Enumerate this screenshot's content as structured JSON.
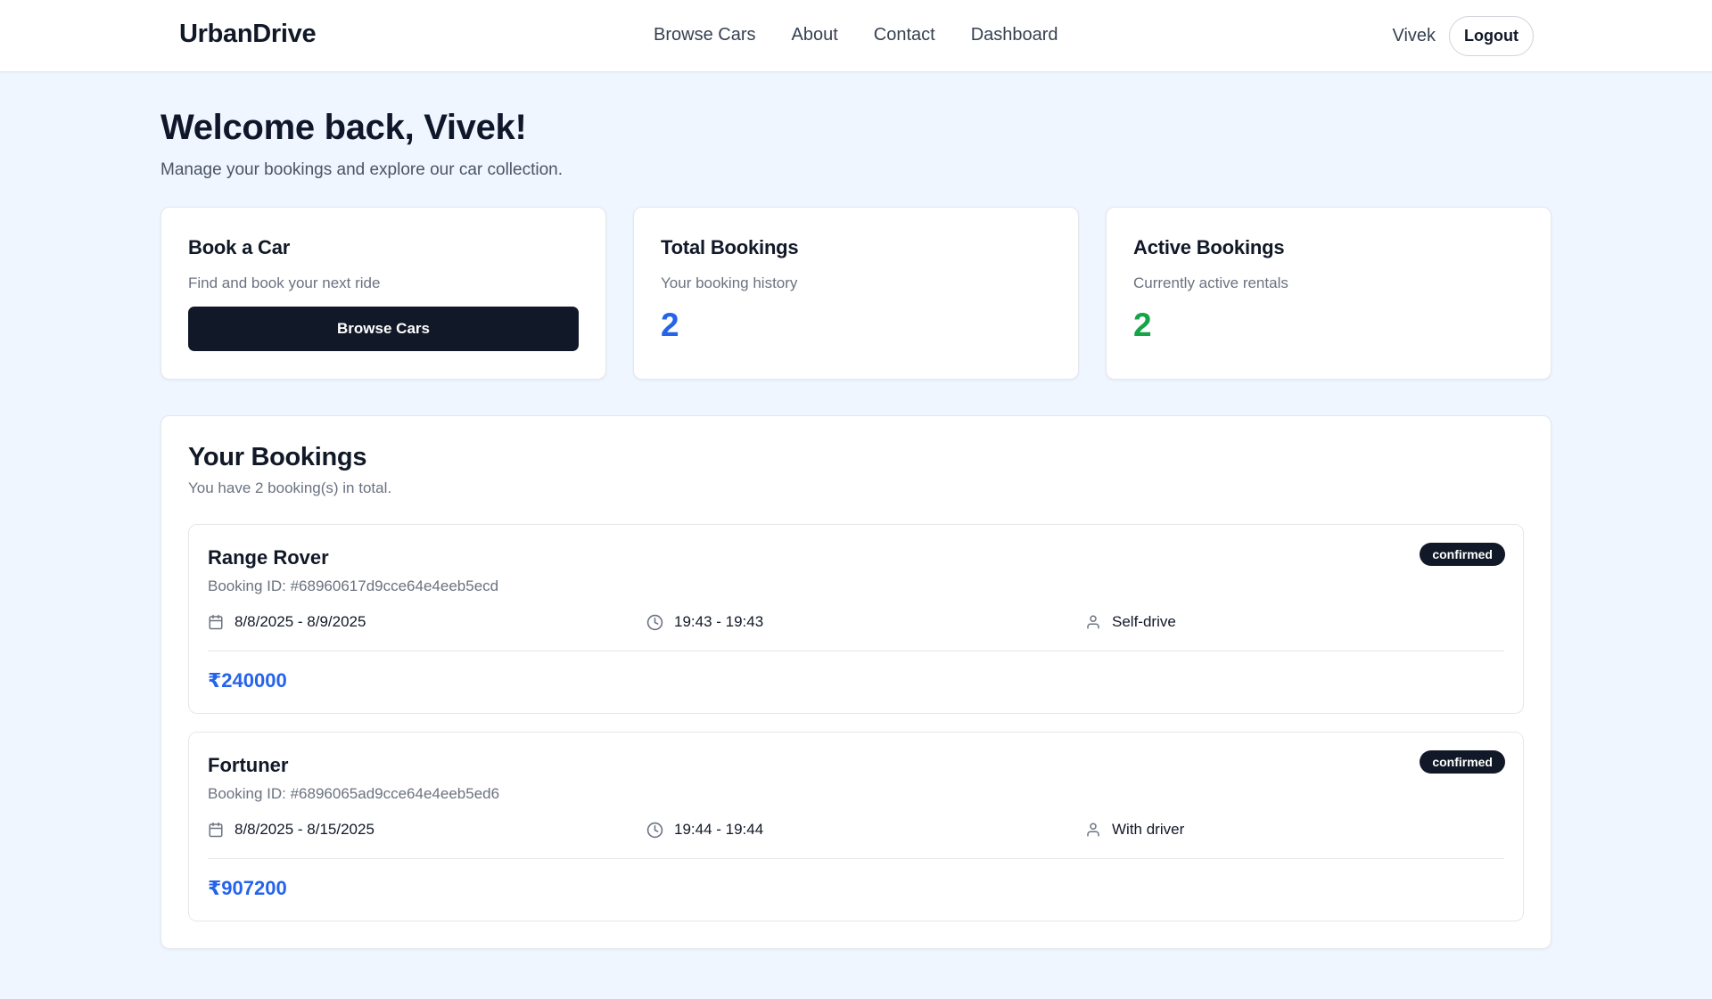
{
  "header": {
    "brand": "UrbanDrive",
    "nav": [
      "Browse Cars",
      "About",
      "Contact",
      "Dashboard"
    ],
    "user_name": "Vivek",
    "logout_label": "Logout"
  },
  "welcome": {
    "title": "Welcome back, Vivek!",
    "subtitle": "Manage your bookings and explore our car collection."
  },
  "cards": {
    "book": {
      "title": "Book a Car",
      "desc": "Find and book your next ride",
      "button": "Browse Cars"
    },
    "total": {
      "title": "Total Bookings",
      "desc": "Your booking history",
      "value": "2"
    },
    "active": {
      "title": "Active Bookings",
      "desc": "Currently active rentals",
      "value": "2"
    }
  },
  "bookings": {
    "title": "Your Bookings",
    "subtitle": "You have 2 booking(s) in total.",
    "items": [
      {
        "car": "Range Rover",
        "booking_id": "Booking ID: #68960617d9cce64e4eeb5ecd",
        "status": "confirmed",
        "dates": "8/8/2025 - 8/9/2025",
        "times": "19:43 - 19:43",
        "drive_type": "Self-drive",
        "price": "₹240000"
      },
      {
        "car": "Fortuner",
        "booking_id": "Booking ID: #6896065ad9cce64e4eeb5ed6",
        "status": "confirmed",
        "dates": "8/8/2025 - 8/15/2025",
        "times": "19:44 - 19:44",
        "drive_type": "With driver",
        "price": "₹907200"
      }
    ]
  },
  "colors": {
    "accent_blue": "#2563eb",
    "accent_green": "#16a34a",
    "dark": "#111827",
    "background": "#eff6ff"
  },
  "icons": [
    "calendar-icon",
    "clock-icon",
    "user-icon"
  ]
}
